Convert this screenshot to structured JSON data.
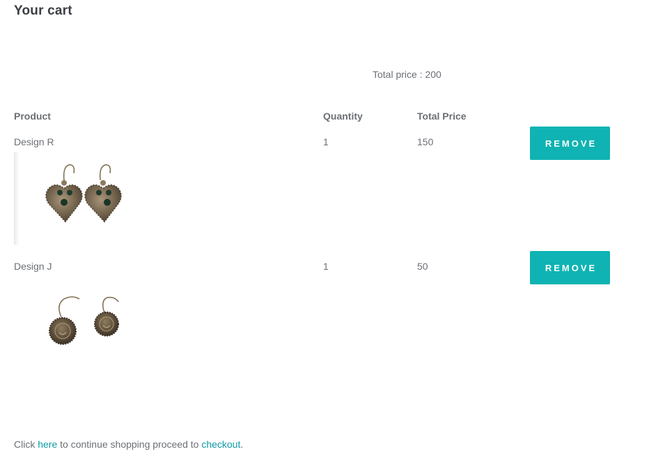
{
  "page": {
    "title": "Your cart"
  },
  "summary": {
    "total_price_text": "Total price : 200"
  },
  "table": {
    "headers": {
      "product": "Product",
      "quantity": "Quantity",
      "total_price": "Total Price"
    },
    "rows": [
      {
        "name": "Design R",
        "quantity": "1",
        "total_price": "150",
        "remove_label": "REMOVE",
        "image_icon": "heart-earrings-image"
      },
      {
        "name": "Design J",
        "quantity": "1",
        "total_price": "50",
        "remove_label": "REMOVE",
        "image_icon": "round-earrings-image"
      }
    ]
  },
  "footer": {
    "text_prefix": "Click ",
    "here_link": "here",
    "text_middle": " to continue shopping proceed to ",
    "checkout_link": "checkout",
    "text_suffix": "."
  },
  "colors": {
    "accent": "#0fb3b3",
    "link": "#0c9aa3",
    "text": "#6b6f75",
    "title": "#3c3f44"
  }
}
